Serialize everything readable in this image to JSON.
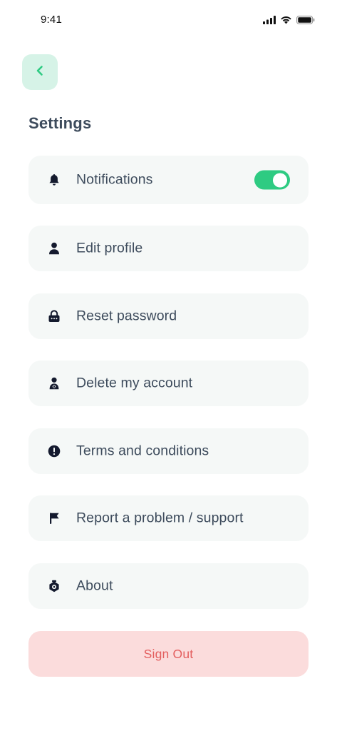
{
  "status_bar": {
    "time": "9:41",
    "icons": [
      "signal-icon",
      "wifi-icon",
      "battery-icon"
    ]
  },
  "header": {
    "back_icon": "chevron-left-icon",
    "title": "Settings"
  },
  "settings_items": [
    {
      "label": "Notifications",
      "icon": "bell-icon",
      "toggle": true
    },
    {
      "label": "Edit profile",
      "icon": "user-icon"
    },
    {
      "label": "Reset password",
      "icon": "lock-icon"
    },
    {
      "label": "Delete my account",
      "icon": "user-delete-icon"
    },
    {
      "label": "Terms and conditions",
      "icon": "alert-circle-icon"
    },
    {
      "label": "Report a problem / support",
      "icon": "flag-icon"
    },
    {
      "label": "About",
      "icon": "info-shield-icon"
    }
  ],
  "sign_out": {
    "label": "Sign Out"
  },
  "colors": {
    "accent": "#2ecb82",
    "back_button_bg": "#d6f3e7",
    "item_bg": "#f5f8f7",
    "text": "#3d4b5c",
    "danger_bg": "#fbdcdc",
    "danger_text": "#e35e5e"
  }
}
